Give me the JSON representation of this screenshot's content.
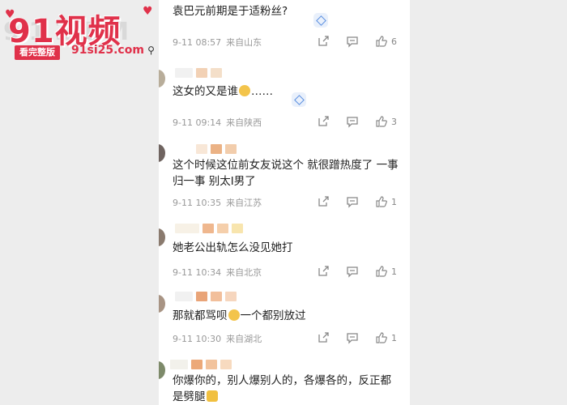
{
  "watermark": {
    "brand": "91视频",
    "badge": "看完整版",
    "url": "91si25.com"
  },
  "comments": [
    {
      "text": "袁巴元前期是于适粉丝?",
      "time": "9-11 08:57",
      "location": "来自山东",
      "likes": "6"
    },
    {
      "text": "这女的又是谁",
      "text_suffix": "……",
      "time": "9-11 09:14",
      "location": "来自陕西",
      "likes": "3"
    },
    {
      "text": "这个时候这位前女友说这个 就很蹭热度了 一事归一事 别太I男了",
      "time": "9-11 10:35",
      "location": "来自江苏",
      "likes": "1"
    },
    {
      "text": "她老公出轨怎么没见她打",
      "time": "9-11 10:34",
      "location": "来自北京",
      "likes": "1"
    },
    {
      "text": "那就都骂呗",
      "text_suffix": "一个都别放过",
      "time": "9-11 10:30",
      "location": "来自湖北",
      "likes": "1"
    },
    {
      "text": "你爆你的，别人爆别人的，各爆各的，反正都是劈腿"
    }
  ],
  "icons": {
    "share": "share-icon",
    "comment": "comment-icon",
    "like": "thumbs-up-icon"
  },
  "colors": {
    "brand_red": "#e0314a",
    "meta_gray": "#999999",
    "diamond_blue": "#5a8fe0"
  }
}
